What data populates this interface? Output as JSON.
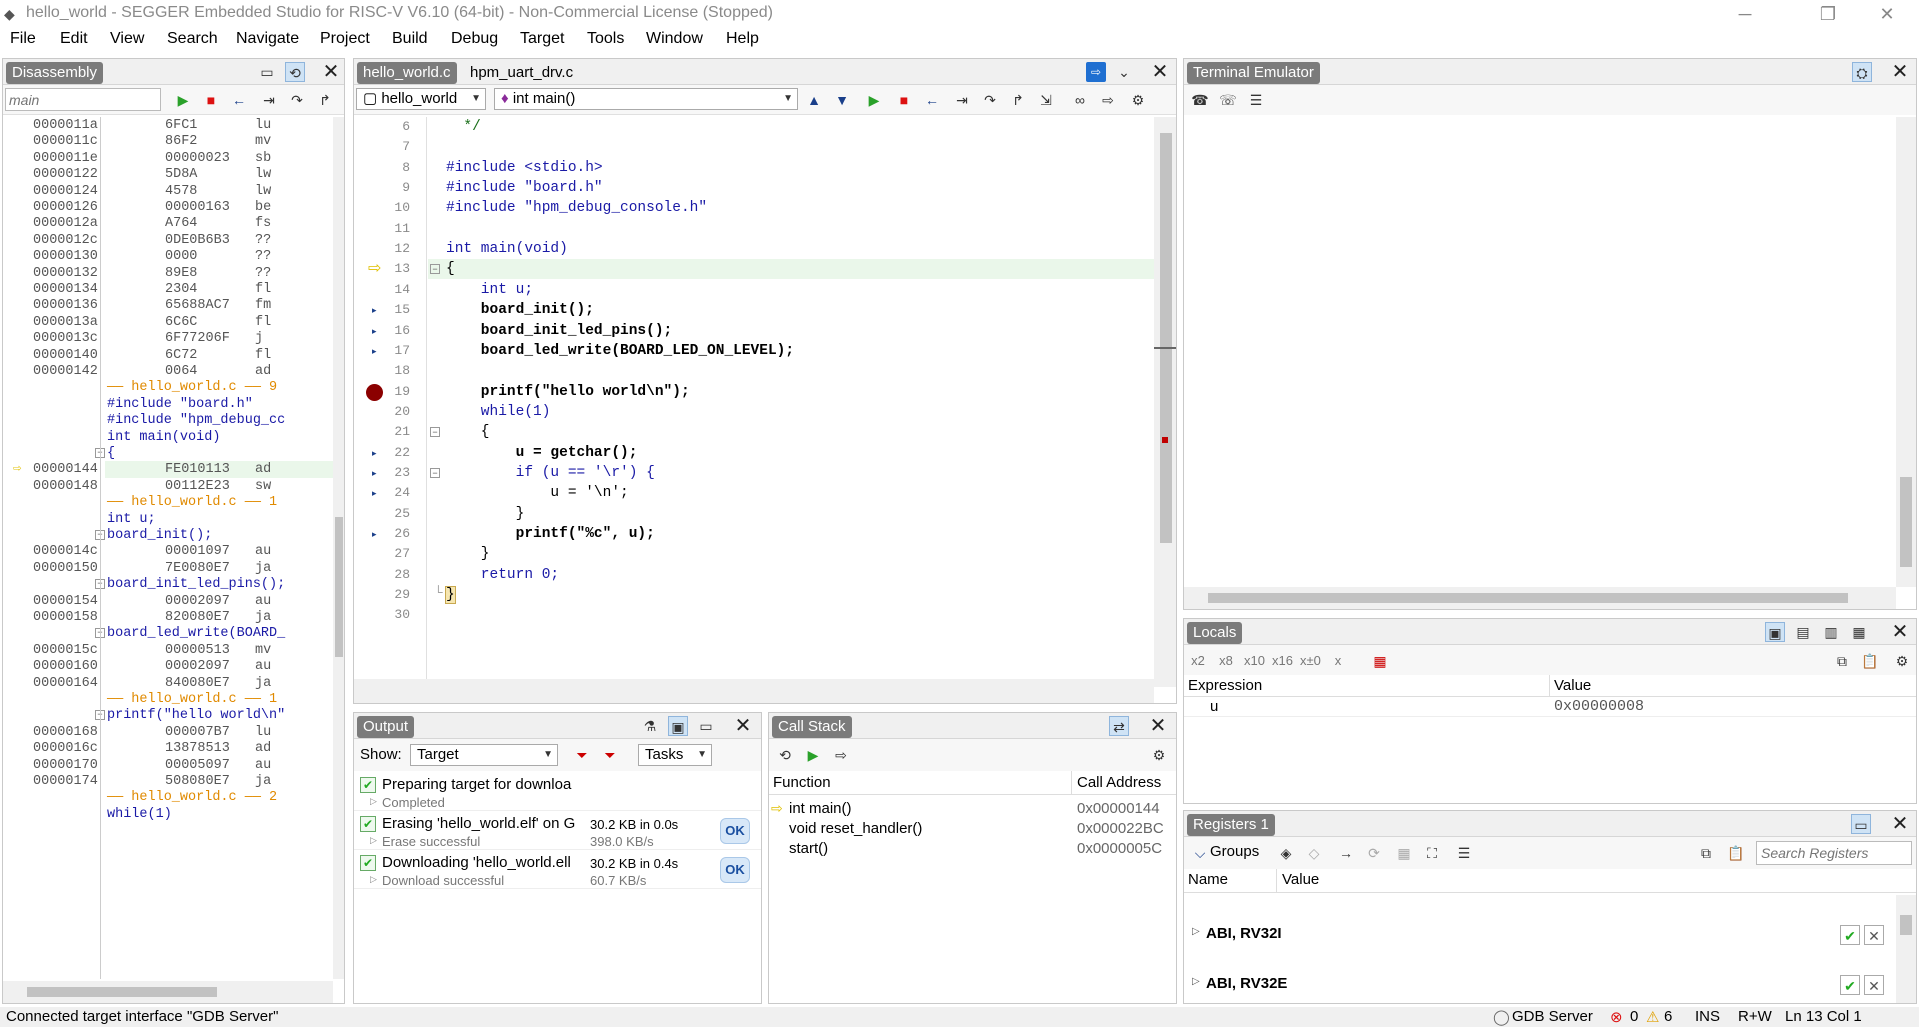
{
  "window": {
    "title": "hello_world - SEGGER Embedded Studio for RISC-V V6.10 (64-bit) - Non-Commercial License (Stopped)"
  },
  "menu": [
    "File",
    "Edit",
    "View",
    "Search",
    "Navigate",
    "Project",
    "Build",
    "Debug",
    "Target",
    "Tools",
    "Window",
    "Help"
  ],
  "disassembly": {
    "title": "Disassembly",
    "search_placeholder": "main",
    "rows": [
      {
        "addr": "0000011a",
        "hex": "6FC1",
        "mn": "lu"
      },
      {
        "addr": "0000011c",
        "hex": "86F2",
        "mn": "mv"
      },
      {
        "addr": "0000011e",
        "hex": "00000023",
        "mn": "sb"
      },
      {
        "addr": "00000122",
        "hex": "5D8A",
        "mn": "lw"
      },
      {
        "addr": "00000124",
        "hex": "4578",
        "mn": "lw"
      },
      {
        "addr": "00000126",
        "hex": "00000163",
        "mn": "be"
      },
      {
        "addr": "0000012a",
        "hex": "A764",
        "mn": "fs"
      },
      {
        "addr": "0000012c",
        "hex": "0DE0B6B3",
        "mn": "??"
      },
      {
        "addr": "00000130",
        "hex": "0000",
        "mn": "??"
      },
      {
        "addr": "00000132",
        "hex": "89E8",
        "mn": "??"
      },
      {
        "addr": "00000134",
        "hex": "2304",
        "mn": "fl"
      },
      {
        "addr": "00000136",
        "hex": "65688AC7",
        "mn": "fm"
      },
      {
        "addr": "0000013a",
        "hex": "6C6C",
        "mn": "fl"
      },
      {
        "addr": "0000013c",
        "hex": "6F77206F",
        "mn": "j"
      },
      {
        "addr": "00000140",
        "hex": "6C72",
        "mn": "fl"
      },
      {
        "addr": "00000142",
        "hex": "0064",
        "mn": "ad"
      },
      {
        "src": "—— hello_world.c —— 9"
      },
      {
        "code": "#include \"board.h\""
      },
      {
        "code": "#include \"hpm_debug_cc"
      },
      {
        "code": "int main(void)"
      },
      {
        "code": "{",
        "fold": true
      },
      {
        "addr": "00000144",
        "hex": "FE010113",
        "mn": "ad",
        "current": true
      },
      {
        "addr": "00000148",
        "hex": "00112E23",
        "mn": "sw"
      },
      {
        "src": "—— hello_world.c —— 1"
      },
      {
        "code": "int u;"
      },
      {
        "code": "board_init();",
        "fold": true
      },
      {
        "addr": "0000014c",
        "hex": "00001097",
        "mn": "au"
      },
      {
        "addr": "00000150",
        "hex": "7E0080E7",
        "mn": "ja"
      },
      {
        "code": "board_init_led_pins();",
        "fold": true
      },
      {
        "addr": "00000154",
        "hex": "00002097",
        "mn": "au"
      },
      {
        "addr": "00000158",
        "hex": "820080E7",
        "mn": "ja"
      },
      {
        "code": "board_led_write(BOARD_",
        "fold": true
      },
      {
        "addr": "0000015c",
        "hex": "00000513",
        "mn": "mv"
      },
      {
        "addr": "00000160",
        "hex": "00002097",
        "mn": "au"
      },
      {
        "addr": "00000164",
        "hex": "840080E7",
        "mn": "ja"
      },
      {
        "src": "—— hello_world.c —— 1"
      },
      {
        "code": "printf(\"hello world\\n\"",
        "fold": true
      },
      {
        "addr": "00000168",
        "hex": "000007B7",
        "mn": "lu"
      },
      {
        "addr": "0000016c",
        "hex": "13878513",
        "mn": "ad"
      },
      {
        "addr": "00000170",
        "hex": "00005097",
        "mn": "au"
      },
      {
        "addr": "00000174",
        "hex": "508080E7",
        "mn": "ja"
      },
      {
        "src": "—— hello_world.c —— 2"
      },
      {
        "code": "while(1)"
      }
    ]
  },
  "editor": {
    "tabs": [
      "hello_world.c",
      "hpm_uart_drv.c"
    ],
    "project_combo": "hello_world",
    "function_combo": "int main()",
    "lines": [
      {
        "n": "6",
        "t": "  */"
      },
      {
        "n": "7",
        "t": ""
      },
      {
        "n": "8",
        "t": "#include <stdio.h>"
      },
      {
        "n": "9",
        "t": "#include \"board.h\""
      },
      {
        "n": "10",
        "t": "#include \"hpm_debug_console.h\""
      },
      {
        "n": "11",
        "t": ""
      },
      {
        "n": "12",
        "t": "int main(void)"
      },
      {
        "n": "13",
        "t": "{"
      },
      {
        "n": "14",
        "t": "    int u;"
      },
      {
        "n": "15",
        "t": "    board_init();"
      },
      {
        "n": "16",
        "t": "    board_init_led_pins();"
      },
      {
        "n": "17",
        "t": "    board_led_write(BOARD_LED_ON_LEVEL);"
      },
      {
        "n": "18",
        "t": ""
      },
      {
        "n": "19",
        "t": "    printf(\"hello world\\n\");"
      },
      {
        "n": "20",
        "t": "    while(1)"
      },
      {
        "n": "21",
        "t": "    {"
      },
      {
        "n": "22",
        "t": "        u = getchar();"
      },
      {
        "n": "23",
        "t": "        if (u == '\\r') {"
      },
      {
        "n": "24",
        "t": "            u = '\\n';"
      },
      {
        "n": "25",
        "t": "        }"
      },
      {
        "n": "26",
        "t": "        printf(\"%c\", u);"
      },
      {
        "n": "27",
        "t": "    }"
      },
      {
        "n": "28",
        "t": "    return 0;"
      },
      {
        "n": "29",
        "t": "}"
      },
      {
        "n": "30",
        "t": ""
      }
    ]
  },
  "terminal": {
    "title": "Terminal Emulator"
  },
  "locals": {
    "title": "Locals",
    "col_expression": "Expression",
    "col_value": "Value",
    "rows": [
      {
        "expr": "u",
        "value": "0x00000008"
      }
    ],
    "toolbar_icons": [
      "x2",
      "x8",
      "x10",
      "x16",
      "x±0",
      "x"
    ]
  },
  "registers": {
    "title": "Registers 1",
    "groups_label": "Groups",
    "search_placeholder": "Search Registers",
    "col_name": "Name",
    "col_value": "Value",
    "groups": [
      "ABI, RV32I",
      "ABI, RV32E"
    ]
  },
  "output": {
    "title": "Output",
    "show_label": "Show:",
    "show_value": "Target",
    "tasks_value": "Tasks",
    "items": [
      {
        "title": "Preparing target for downloa",
        "sub": "Completed",
        "size": "",
        "rate": "",
        "ok": false
      },
      {
        "title": "Erasing 'hello_world.elf' on G",
        "sub": "Erase successful",
        "size": "30.2 KB in 0.0s",
        "rate": "398.0 KB/s",
        "ok": true,
        "ok_label": "OK"
      },
      {
        "title": "Downloading 'hello_world.ell",
        "sub": "Download successful",
        "size": "30.2 KB in 0.4s",
        "rate": "60.7 KB/s",
        "ok": true,
        "ok_label": "OK"
      }
    ]
  },
  "callstack": {
    "title": "Call Stack",
    "col_function": "Function",
    "col_address": "Call Address",
    "rows": [
      {
        "fn": "int main()",
        "addr": "0x00000144",
        "current": true
      },
      {
        "fn": "void reset_handler()",
        "addr": "0x000022BC",
        "current": false
      },
      {
        "fn": "start()",
        "addr": "0x0000005C",
        "current": false
      }
    ]
  },
  "status": {
    "left": "Connected target interface \"GDB Server\"",
    "server": "GDB Server",
    "errors": "0",
    "warnings": "6",
    "ins": "INS",
    "rw": "R+W",
    "pos": "Ln 13 Col 1"
  },
  "colors": {
    "accent_title": "#7b7b7b",
    "source_line": "#e08a00",
    "keyword": "#1a1aa6",
    "string": "#c00000",
    "breakpoint": "#8b0000",
    "current_line": "#eaf7ea"
  }
}
